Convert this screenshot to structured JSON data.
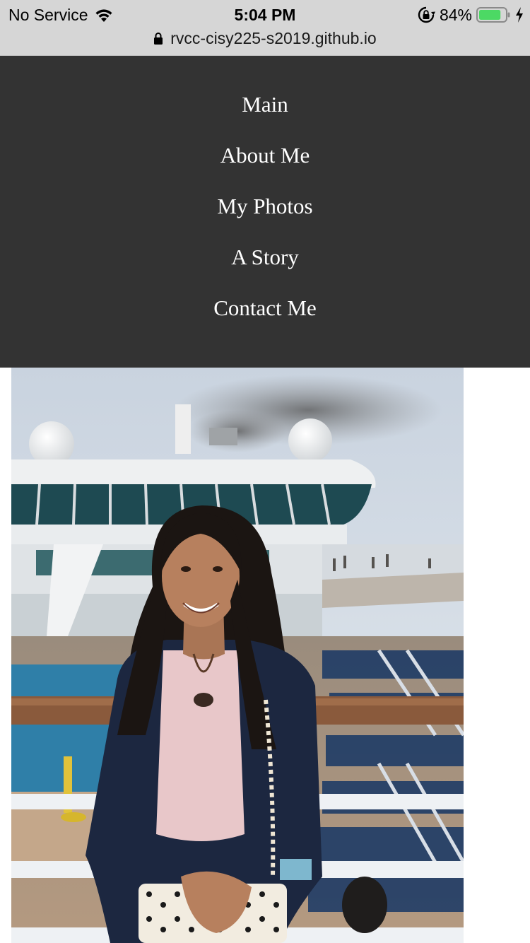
{
  "status_bar": {
    "carrier": "No Service",
    "time": "5:04 PM",
    "battery_percent": "84%",
    "battery_level": 0.84,
    "icons": [
      "wifi-icon",
      "rotation-lock-icon",
      "battery-icon",
      "charging-bolt-icon"
    ]
  },
  "browser": {
    "url": "rvcc-cisy225-s2019.github.io",
    "secure_icon": "lock-icon"
  },
  "nav": {
    "items": [
      {
        "label": "Main"
      },
      {
        "label": "About Me"
      },
      {
        "label": "My Photos"
      },
      {
        "label": "A Story"
      },
      {
        "label": "Contact Me"
      }
    ]
  },
  "colors": {
    "nav_background": "#333333",
    "nav_text": "#ffffff",
    "chrome_background": "#d6d6d6",
    "battery_fill": "#4cd964"
  }
}
